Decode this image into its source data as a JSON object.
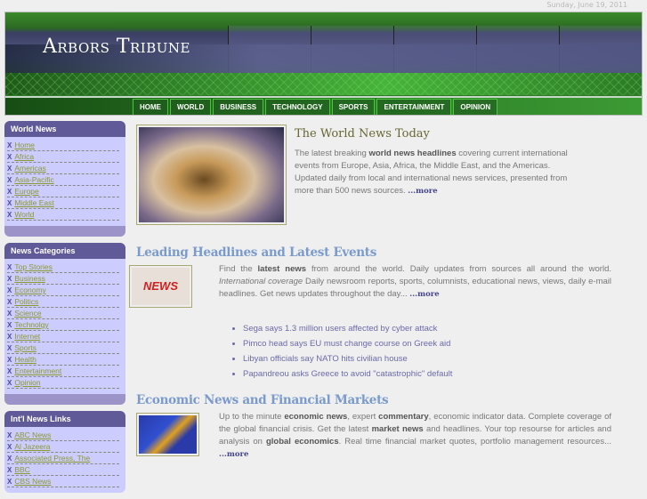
{
  "date": "Sunday, June 19, 2011",
  "logo": "Arbors Tribune",
  "nav": [
    "HOME",
    "WORLD",
    "BUSINESS",
    "TECHNOLOGY",
    "SPORTS",
    "ENTERTAINMENT",
    "OPINION"
  ],
  "sidebar": [
    {
      "title": "World News",
      "items": [
        "Home",
        "Africa",
        "Americas",
        "Asia-Pacific",
        "Europe",
        "Middle East",
        "World"
      ]
    },
    {
      "title": "News Categories",
      "items": [
        "Top Stories",
        "Business",
        "Economy",
        "Politics",
        "Science",
        "Technolgy",
        "Internet",
        "Sports",
        "Health",
        "Entertainment",
        "Opinion"
      ]
    },
    {
      "title": "Int'l News Links",
      "items": [
        "ABC News",
        "Al Jazeera",
        "Associated Press, The",
        "BBC",
        "CBS News"
      ]
    }
  ],
  "bullet": "X",
  "intro": {
    "title": "The World News Today",
    "p1": "The latest breaking ",
    "b1": "world news headlines",
    "p2": " covering current international events from Europe, Asia, Africa, the Middle East, and the Americas. Updated daily from local and international news services, presented from more than 500 news sources. ",
    "more": "...more"
  },
  "leading": {
    "title": "Leading Headlines and Latest Events",
    "img_text": "NEWS",
    "p1": "Find the ",
    "b1": "latest news",
    "p2": " from around the world. Daily updates from sources all around the world. ",
    "i1": "International coverage",
    "p3": " Daily newsroom reports, sports, columnists, educational news, views, daily e-mail headlines. Get news updates throughout the day... ",
    "more": "...more",
    "headlines": [
      "Sega says 1.3 million users affected by cyber attack",
      "Pimco head says EU must change course on Greek aid",
      "Libyan officials say NATO hits civilian house",
      "Papandreou asks Greece to avoid \"catastrophic\" default"
    ]
  },
  "economic": {
    "title": "Economic News and Financial Markets",
    "p1": "Up to the minute ",
    "b1": "economic news",
    "p2": ", expert ",
    "b2": "commentary",
    "p3": ", economic indicator data. Complete coverage of the global financial crisis. Get the latest ",
    "b3": "market news",
    "p4": " and headlines. Your top resourse for articles and analysis on ",
    "b4": "global economics",
    "p5": ". Real time financial market quotes, portfolio management resources... ",
    "more": "...more"
  }
}
